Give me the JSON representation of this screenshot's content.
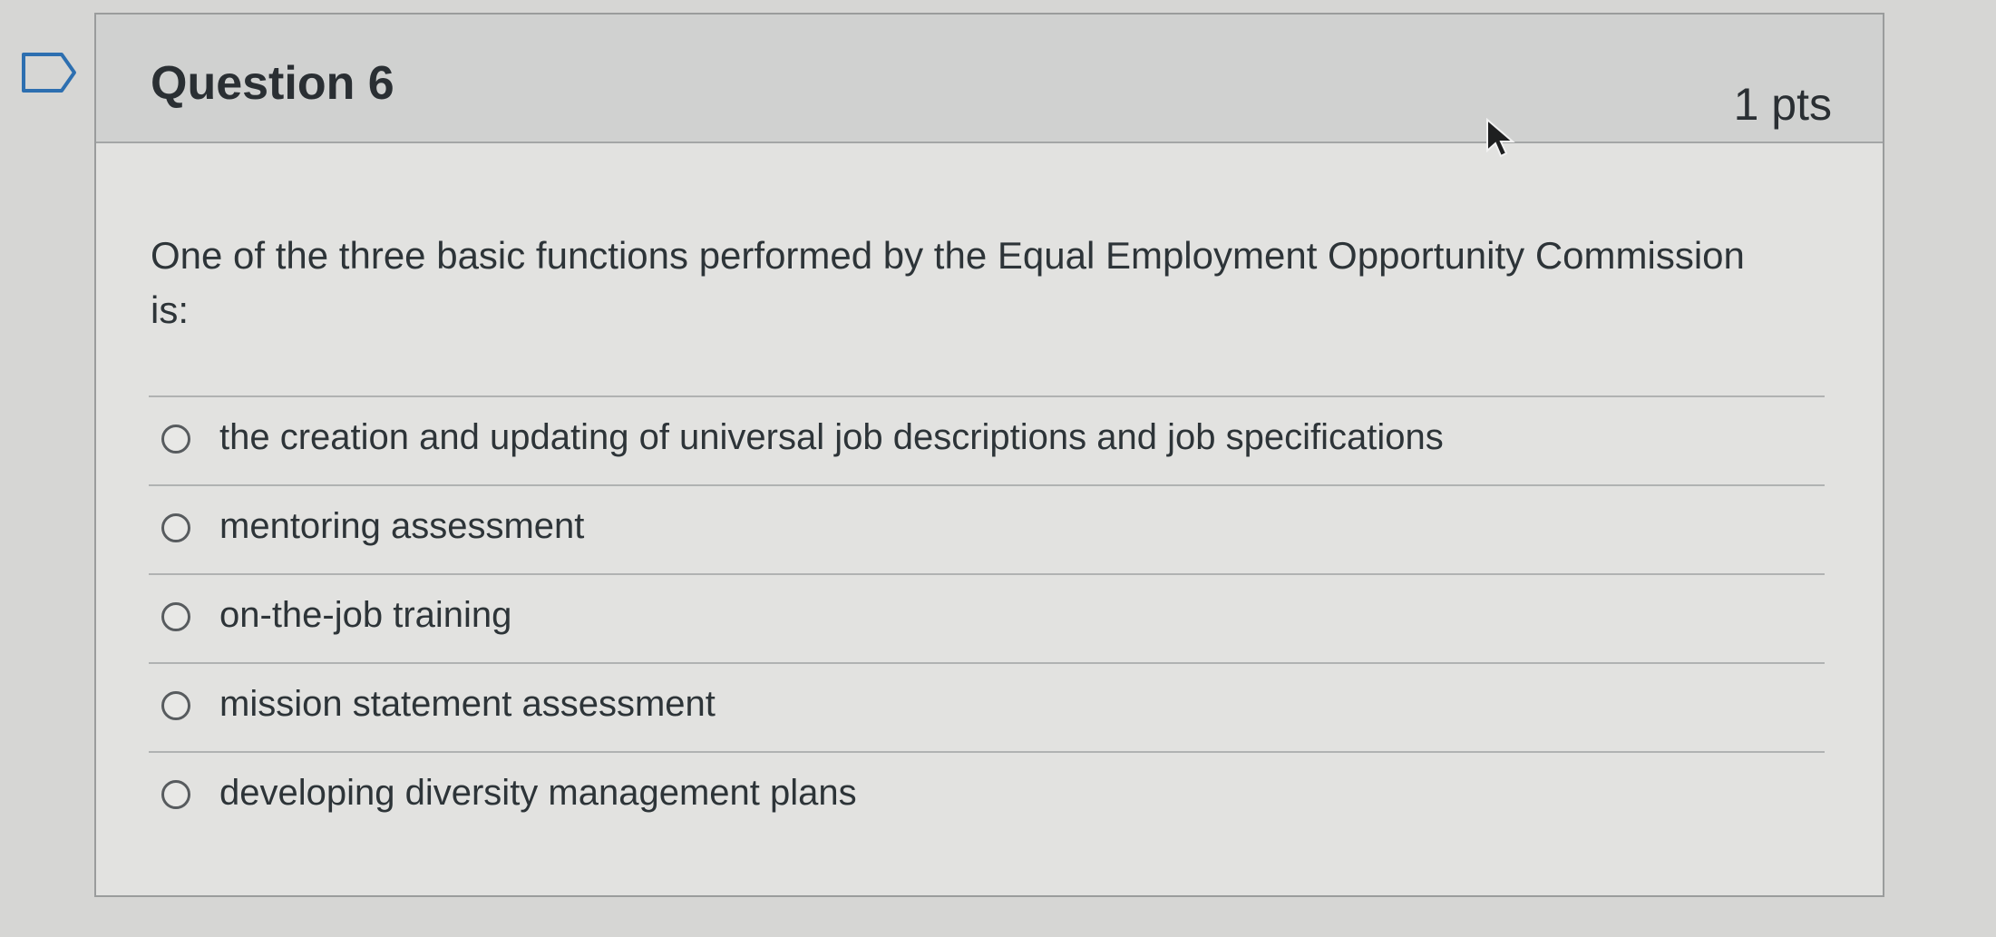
{
  "question": {
    "title": "Question 6",
    "points": "1 pts",
    "text": "One of the three basic functions performed by the Equal Employment Opportunity Commission is:",
    "answers": [
      {
        "label": "the creation and updating of universal job descriptions and job specifications",
        "selected": false
      },
      {
        "label": "mentoring assessment",
        "selected": false
      },
      {
        "label": "on-the-job training",
        "selected": false
      },
      {
        "label": "mission statement assessment",
        "selected": false
      },
      {
        "label": "developing diversity management plans",
        "selected": false
      }
    ]
  },
  "icons": {
    "flag": "flag-question-icon",
    "cursor": "mouse-pointer-icon"
  },
  "colors": {
    "header_bg": "#d0d1d0",
    "card_bg": "#e2e2e0",
    "text": "#2d3438"
  }
}
